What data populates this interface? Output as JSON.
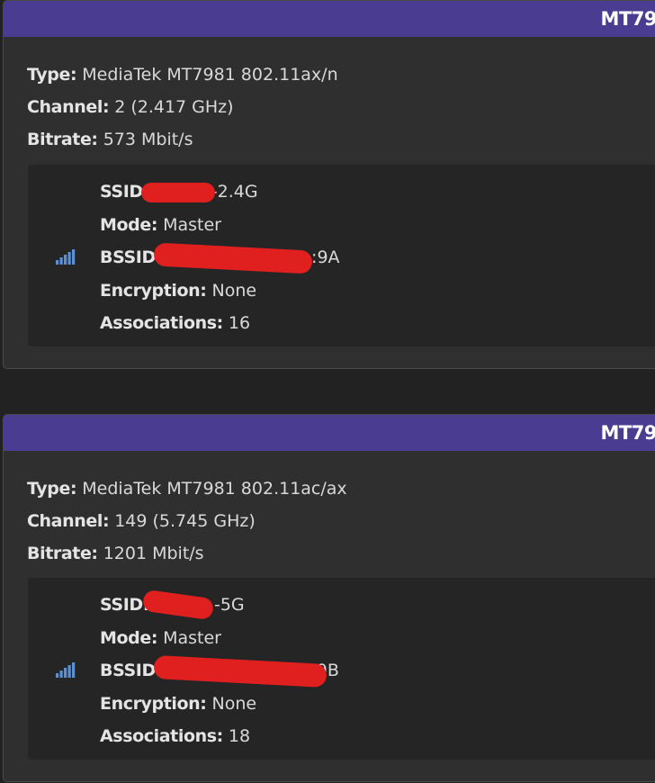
{
  "radios": [
    {
      "title": "MT79",
      "type_label": "Type:",
      "type_value": "MediaTek MT7981 802.11ax/n",
      "channel_label": "Channel:",
      "channel_value": "2 (2.417 GHz)",
      "bitrate_label": "Bitrate:",
      "bitrate_value": "573 Mbit/s",
      "network": {
        "icon": "signal-icon",
        "ssid_label": "SSID",
        "ssid_value": "-2.4G",
        "mode_label": "Mode:",
        "mode_value": "Master",
        "bssid_label": "BSSID:",
        "bssid_value": ":9A",
        "encryption_label": "Encryption:",
        "encryption_value": "None",
        "associations_label": "Associations:",
        "associations_value": "16"
      }
    },
    {
      "title": "MT79",
      "type_label": "Type:",
      "type_value": "MediaTek MT7981 802.11ac/ax",
      "channel_label": "Channel:",
      "channel_value": "149 (5.745 GHz)",
      "bitrate_label": "Bitrate:",
      "bitrate_value": "1201 Mbit/s",
      "network": {
        "icon": "signal-icon",
        "ssid_label": "SSID:",
        "ssid_value": "-5G",
        "mode_label": "Mode:",
        "mode_value": "Master",
        "bssid_label": "BSSID:",
        "bssid_value": "4C:9B",
        "encryption_label": "Encryption:",
        "encryption_value": "None",
        "associations_label": "Associations:",
        "associations_value": "18"
      }
    }
  ],
  "colors": {
    "header": "#4a3d91",
    "card": "#2f2f2f",
    "network_box": "#252525",
    "redaction": "#e01f1f",
    "signal_icon": "#5b8fd6"
  }
}
